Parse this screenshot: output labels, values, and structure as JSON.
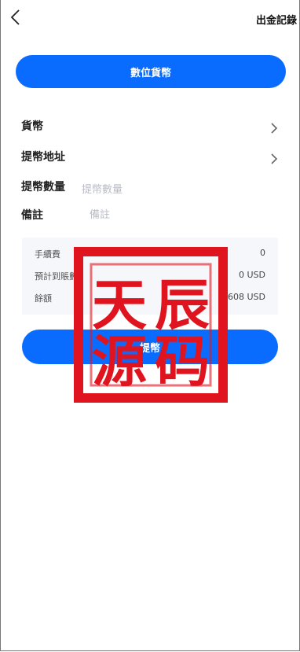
{
  "header": {
    "records_label": "出金記錄"
  },
  "main": {
    "currency_type_button": "數位貨幣",
    "fields": [
      {
        "label": "貨幣"
      },
      {
        "label": "提幣地址"
      },
      {
        "label": "提幣數量",
        "placeholder": "提幣數量"
      },
      {
        "label": "備註",
        "placeholder": "備註"
      }
    ]
  },
  "summary": {
    "fee_label": "手續費",
    "fee_value": "0",
    "expected_label": "預計到賬數",
    "expected_value": "0 USD",
    "balance_label": "餘額",
    "balance_value": "608 USD"
  },
  "submit_label": "提幣",
  "watermark": {
    "text": "天辰源码"
  },
  "colors": {
    "accent": "#0a6cff",
    "stamp": "#e0141e"
  },
  "icons": {
    "back": "chevron-left-icon",
    "row_arrow": "chevron-right-icon"
  }
}
